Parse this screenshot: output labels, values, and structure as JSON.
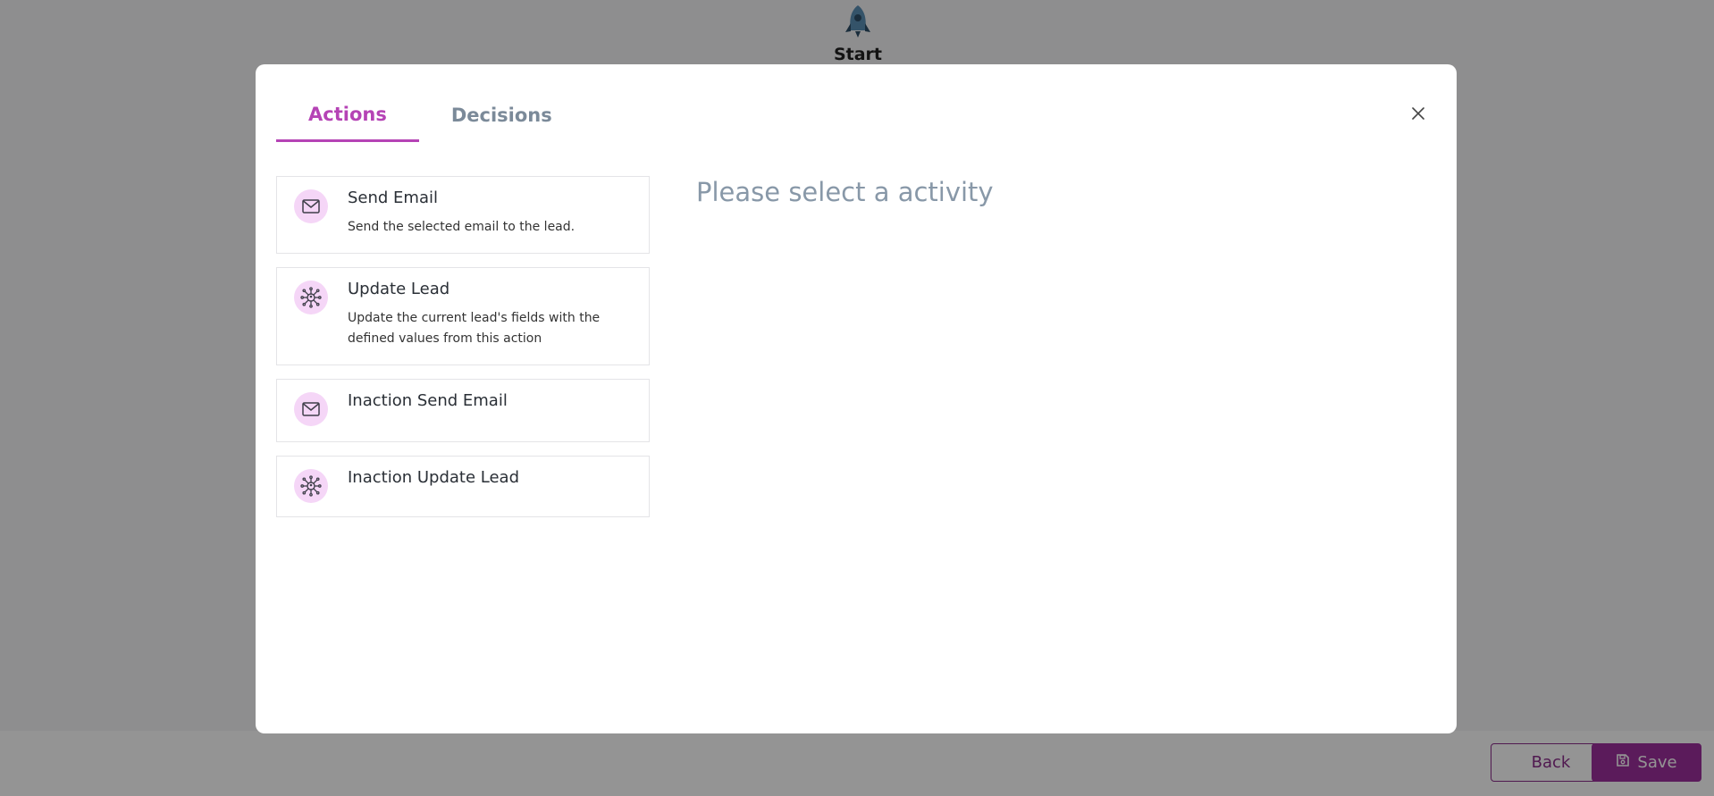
{
  "canvas": {
    "start_label": "Start"
  },
  "footer": {
    "back_label": "Back",
    "save_label": "Save"
  },
  "modal": {
    "tabs": [
      {
        "label": "Actions",
        "active": true
      },
      {
        "label": "Decisions",
        "active": false
      }
    ],
    "activities": [
      {
        "title": "Send Email",
        "description": "Send the selected email to the lead.",
        "icon": "mail-icon"
      },
      {
        "title": "Update Lead",
        "description": "Update the current lead's fields with the defined values from this action",
        "icon": "network-icon"
      },
      {
        "title": "Inaction Send Email",
        "description": "",
        "icon": "mail-icon"
      },
      {
        "title": "Inaction Update Lead",
        "description": "",
        "icon": "network-icon"
      }
    ],
    "placeholder": "Please select a activity"
  },
  "colors": {
    "accent": "#b543b5",
    "save_button": "#9d2f9d",
    "icon_bg": "#f5d6f7",
    "overlay": "rgba(0,0,0,0.42)"
  }
}
